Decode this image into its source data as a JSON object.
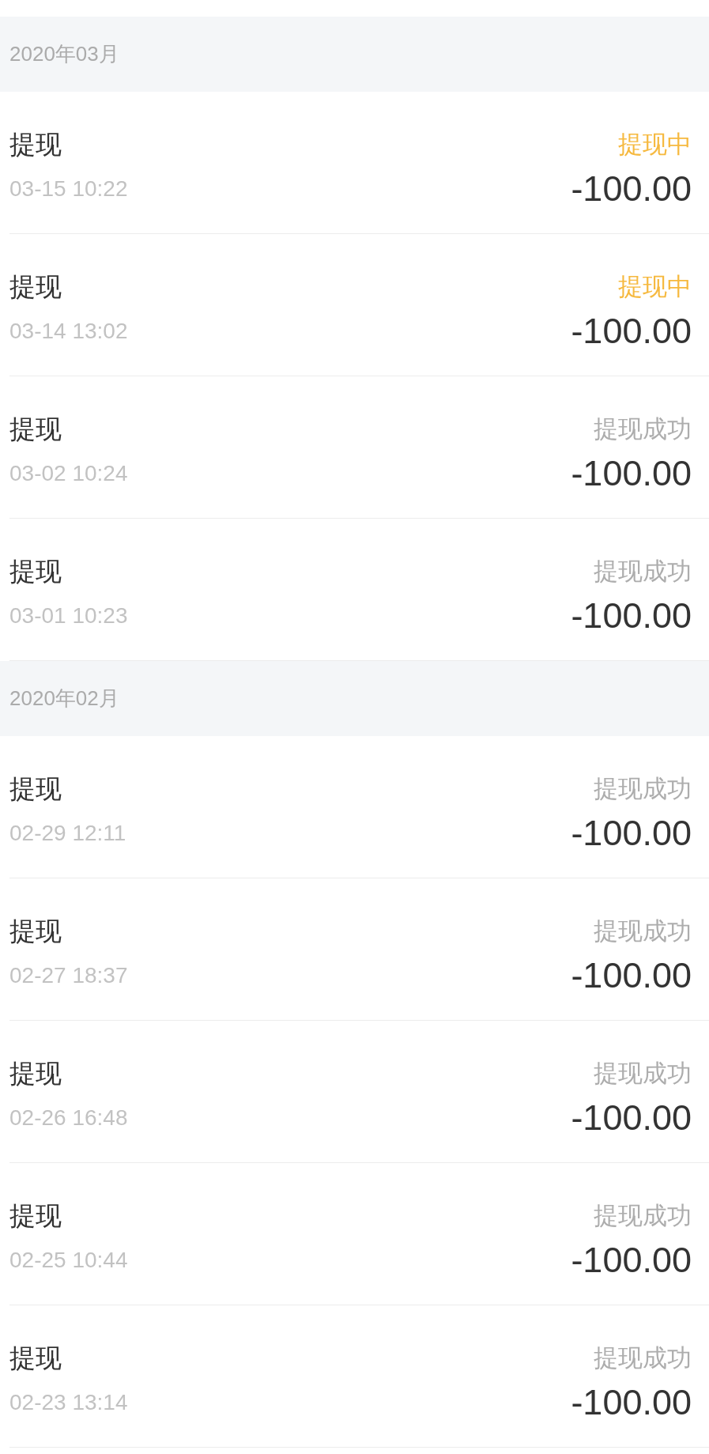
{
  "sections": [
    {
      "header": "2020年03月",
      "rows": [
        {
          "title": "提现",
          "time": "03-15 10:22",
          "status": "提现中",
          "kind": "pending",
          "amount": "-100.00"
        },
        {
          "title": "提现",
          "time": "03-14 13:02",
          "status": "提现中",
          "kind": "pending",
          "amount": "-100.00"
        },
        {
          "title": "提现",
          "time": "03-02 10:24",
          "status": "提现成功",
          "kind": "success",
          "amount": "-100.00"
        },
        {
          "title": "提现",
          "time": "03-01 10:23",
          "status": "提现成功",
          "kind": "success",
          "amount": "-100.00"
        }
      ]
    },
    {
      "header": "2020年02月",
      "rows": [
        {
          "title": "提现",
          "time": "02-29 12:11",
          "status": "提现成功",
          "kind": "success",
          "amount": "-100.00"
        },
        {
          "title": "提现",
          "time": "02-27 18:37",
          "status": "提现成功",
          "kind": "success",
          "amount": "-100.00"
        },
        {
          "title": "提现",
          "time": "02-26 16:48",
          "status": "提现成功",
          "kind": "success",
          "amount": "-100.00"
        },
        {
          "title": "提现",
          "time": "02-25 10:44",
          "status": "提现成功",
          "kind": "success",
          "amount": "-100.00"
        },
        {
          "title": "提现",
          "time": "02-23 13:14",
          "status": "提现成功",
          "kind": "success",
          "amount": "-100.00"
        }
      ]
    }
  ]
}
